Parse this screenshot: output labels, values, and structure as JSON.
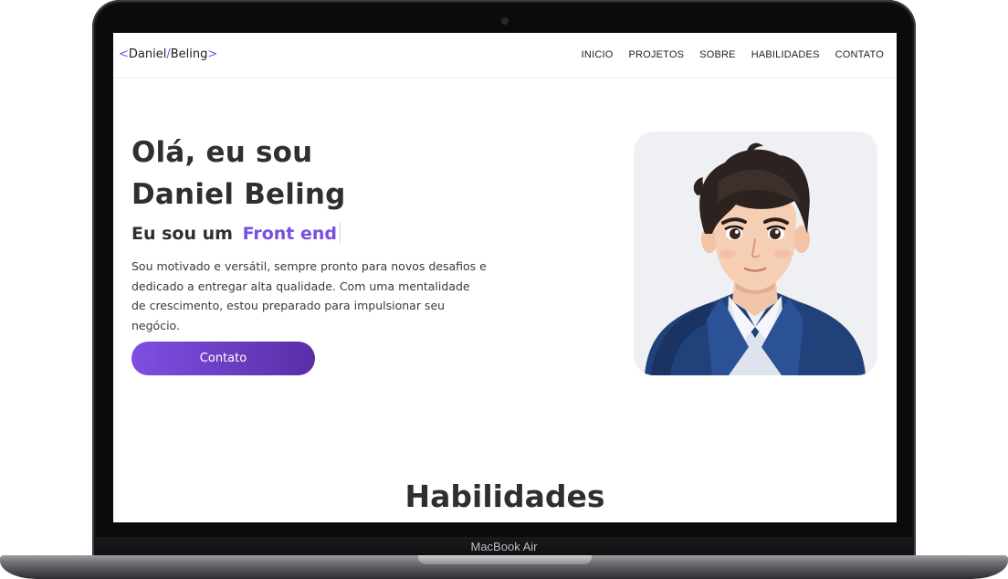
{
  "device": {
    "label": "MacBook Air"
  },
  "nav": {
    "logo": {
      "open": "<",
      "name": "Daniel",
      "slash": "/",
      "surname": "Beling",
      "close": ">"
    },
    "items": [
      "INICIO",
      "PROJETOS",
      "SOBRE",
      "HABILIDADES",
      "CONTATO"
    ]
  },
  "hero": {
    "title_line1": "Olá, eu sou",
    "title_line2": "Daniel Beling",
    "subtitle_prefix": "Eu sou um",
    "role": "Front end",
    "description": "Sou motivado e versátil, sempre pronto para novos desafios e dedicado a entregar alta qualidade. Com uma mentalidade de crescimento, estou preparado para impulsionar seu negócio.",
    "cta_label": "Contato"
  },
  "skills": {
    "title": "Habilidades"
  },
  "colors": {
    "accent": "#7b4ee3",
    "accent_dark": "#5a2ea6",
    "text": "#2f2f33",
    "avatar_bg": "#eff0f3"
  }
}
